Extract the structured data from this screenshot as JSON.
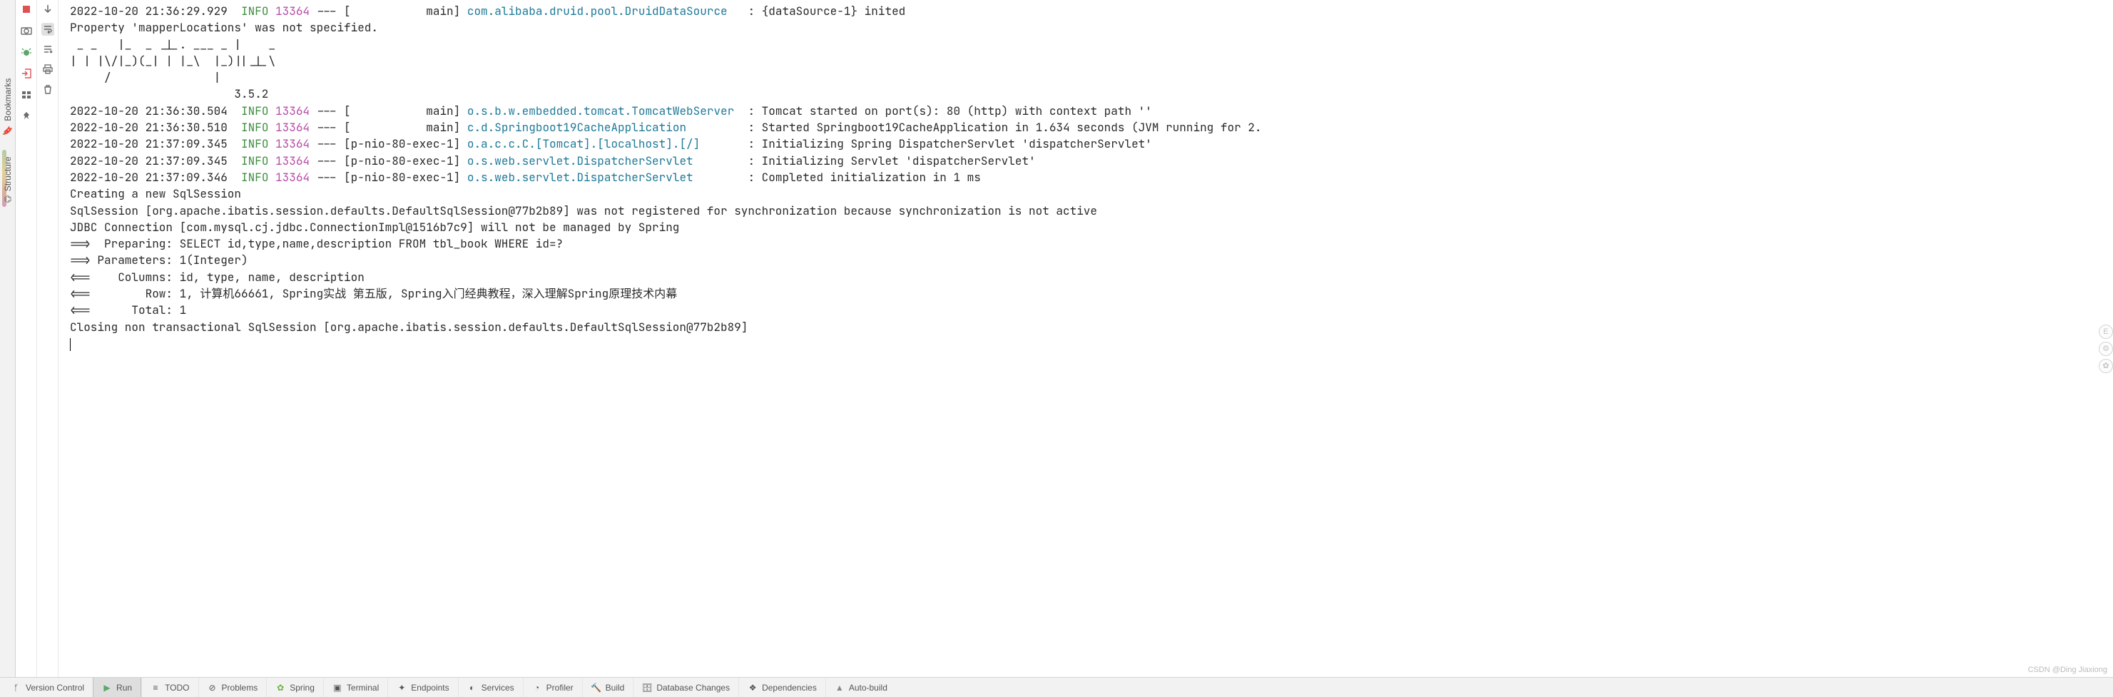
{
  "sidebar_vertical": {
    "bookmarks": "Bookmarks",
    "structure": "Structure"
  },
  "gutter_icons": {
    "stop": "stop-icon",
    "camera": "camera-icon",
    "bug": "bug-icon",
    "exit": "exit-icon",
    "layout": "layout-icon",
    "pin": "pin-icon",
    "down": "scroll-to-end-icon",
    "wrap": "soft-wrap-icon",
    "stack": "scroll-to-stack-icon",
    "print": "print-icon",
    "trash": "clear-icon"
  },
  "log_structured": [
    {
      "ts": "2022-10-20 21:36:29.929",
      "lvl": "INFO",
      "pid": "13364",
      "sep": " --- [           main] ",
      "cls": "com.alibaba.druid.pool.DruidDataSource  ",
      "msg": " : {dataSource-1} inited"
    },
    {
      "plain": "Property 'mapperLocations' was not specified."
    },
    {
      "plain": " _ _   |_  _ _|_. ___ _ |    _"
    },
    {
      "plain": "| | |\\/|_)(_| | |_\\  |_)||_|_\\"
    },
    {
      "plain": "     /               |"
    },
    {
      "plain": "                        3.5.2"
    },
    {
      "ts": "2022-10-20 21:36:30.504",
      "lvl": "INFO",
      "pid": "13364",
      "sep": " --- [           main] ",
      "cls": "o.s.b.w.embedded.tomcat.TomcatWebServer ",
      "msg": " : Tomcat started on port(s): 80 (http) with context path ''"
    },
    {
      "ts": "2022-10-20 21:36:30.510",
      "lvl": "INFO",
      "pid": "13364",
      "sep": " --- [           main] ",
      "cls": "c.d.Springboot19CacheApplication        ",
      "msg": " : Started Springboot19CacheApplication in 1.634 seconds (JVM running for 2."
    },
    {
      "ts": "2022-10-20 21:37:09.345",
      "lvl": "INFO",
      "pid": "13364",
      "sep": " --- [p-nio-80-exec-1] ",
      "cls": "o.a.c.c.C.[Tomcat].[localhost].[/]      ",
      "msg": " : Initializing Spring DispatcherServlet 'dispatcherServlet'"
    },
    {
      "ts": "2022-10-20 21:37:09.345",
      "lvl": "INFO",
      "pid": "13364",
      "sep": " --- [p-nio-80-exec-1] ",
      "cls": "o.s.web.servlet.DispatcherServlet       ",
      "msg": " : Initializing Servlet 'dispatcherServlet'"
    },
    {
      "ts": "2022-10-20 21:37:09.346",
      "lvl": "INFO",
      "pid": "13364",
      "sep": " --- [p-nio-80-exec-1] ",
      "cls": "o.s.web.servlet.DispatcherServlet       ",
      "msg": " : Completed initialization in 1 ms"
    },
    {
      "plain": "Creating a new SqlSession"
    },
    {
      "plain": "SqlSession [org.apache.ibatis.session.defaults.DefaultSqlSession@77b2b89] was not registered for synchronization because synchronization is not active"
    },
    {
      "plain": "JDBC Connection [com.mysql.cj.jdbc.ConnectionImpl@1516b7c9] will not be managed by Spring"
    },
    {
      "plain": "==>  Preparing: SELECT id,type,name,description FROM tbl_book WHERE id=?"
    },
    {
      "plain": "==> Parameters: 1(Integer)"
    },
    {
      "plain": "<==    Columns: id, type, name, description"
    },
    {
      "plain": "<==        Row: 1, 计算机66661, Spring实战 第五版, Spring入门经典教程，深入理解Spring原理技术内幕"
    },
    {
      "plain": "<==      Total: 1"
    },
    {
      "plain": "Closing non transactional SqlSession [org.apache.ibatis.session.defaults.DefaultSqlSession@77b2b89]"
    }
  ],
  "bottom_tabs": {
    "version_control": "Version Control",
    "run": "Run",
    "todo": "TODO",
    "problems": "Problems",
    "spring": "Spring",
    "terminal": "Terminal",
    "endpoints": "Endpoints",
    "services": "Services",
    "profiler": "Profiler",
    "build": "Build",
    "database_changes": "Database Changes",
    "dependencies": "Dependencies",
    "auto_build": "Auto-build"
  },
  "watermark": "CSDN @Ding Jiaxiong"
}
